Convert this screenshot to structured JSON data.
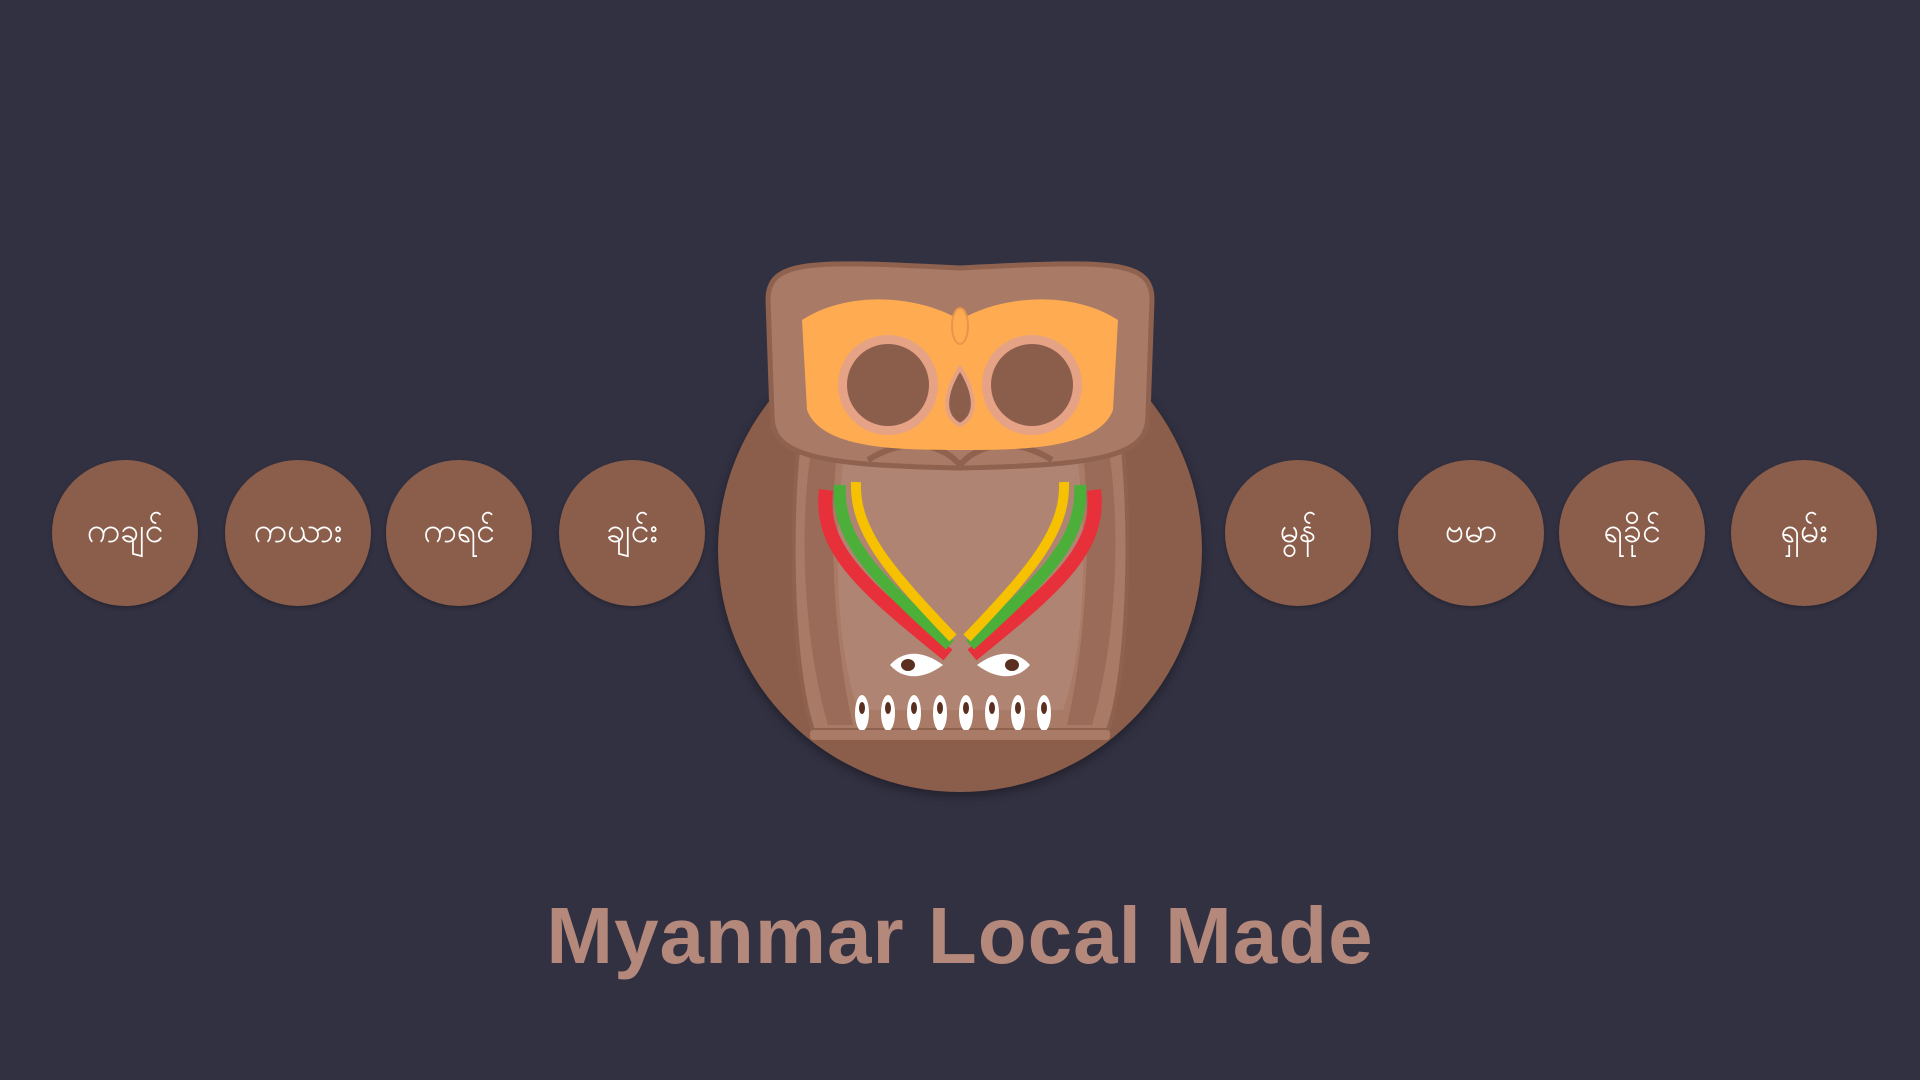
{
  "states_left": [
    {
      "label": "ကချင်"
    },
    {
      "label": "ကယား"
    },
    {
      "label": "ကရင်"
    },
    {
      "label": "ချင်း"
    }
  ],
  "states_right": [
    {
      "label": "မွန်"
    },
    {
      "label": "ဗမာ"
    },
    {
      "label": "ရခိုင်"
    },
    {
      "label": "ရှမ်း"
    }
  ],
  "brand": {
    "title": "Myanmar Local Made"
  },
  "colors": {
    "background": "#323142",
    "disc": "#8b5e4b",
    "owl_body": "#a97a66",
    "owl_mask": "#ffab52",
    "title": "#b4887a",
    "stripe_red": "#e8303a",
    "stripe_green": "#4caf3a",
    "stripe_yellow": "#f6c100"
  },
  "icons": [
    "owl-logo-icon"
  ]
}
